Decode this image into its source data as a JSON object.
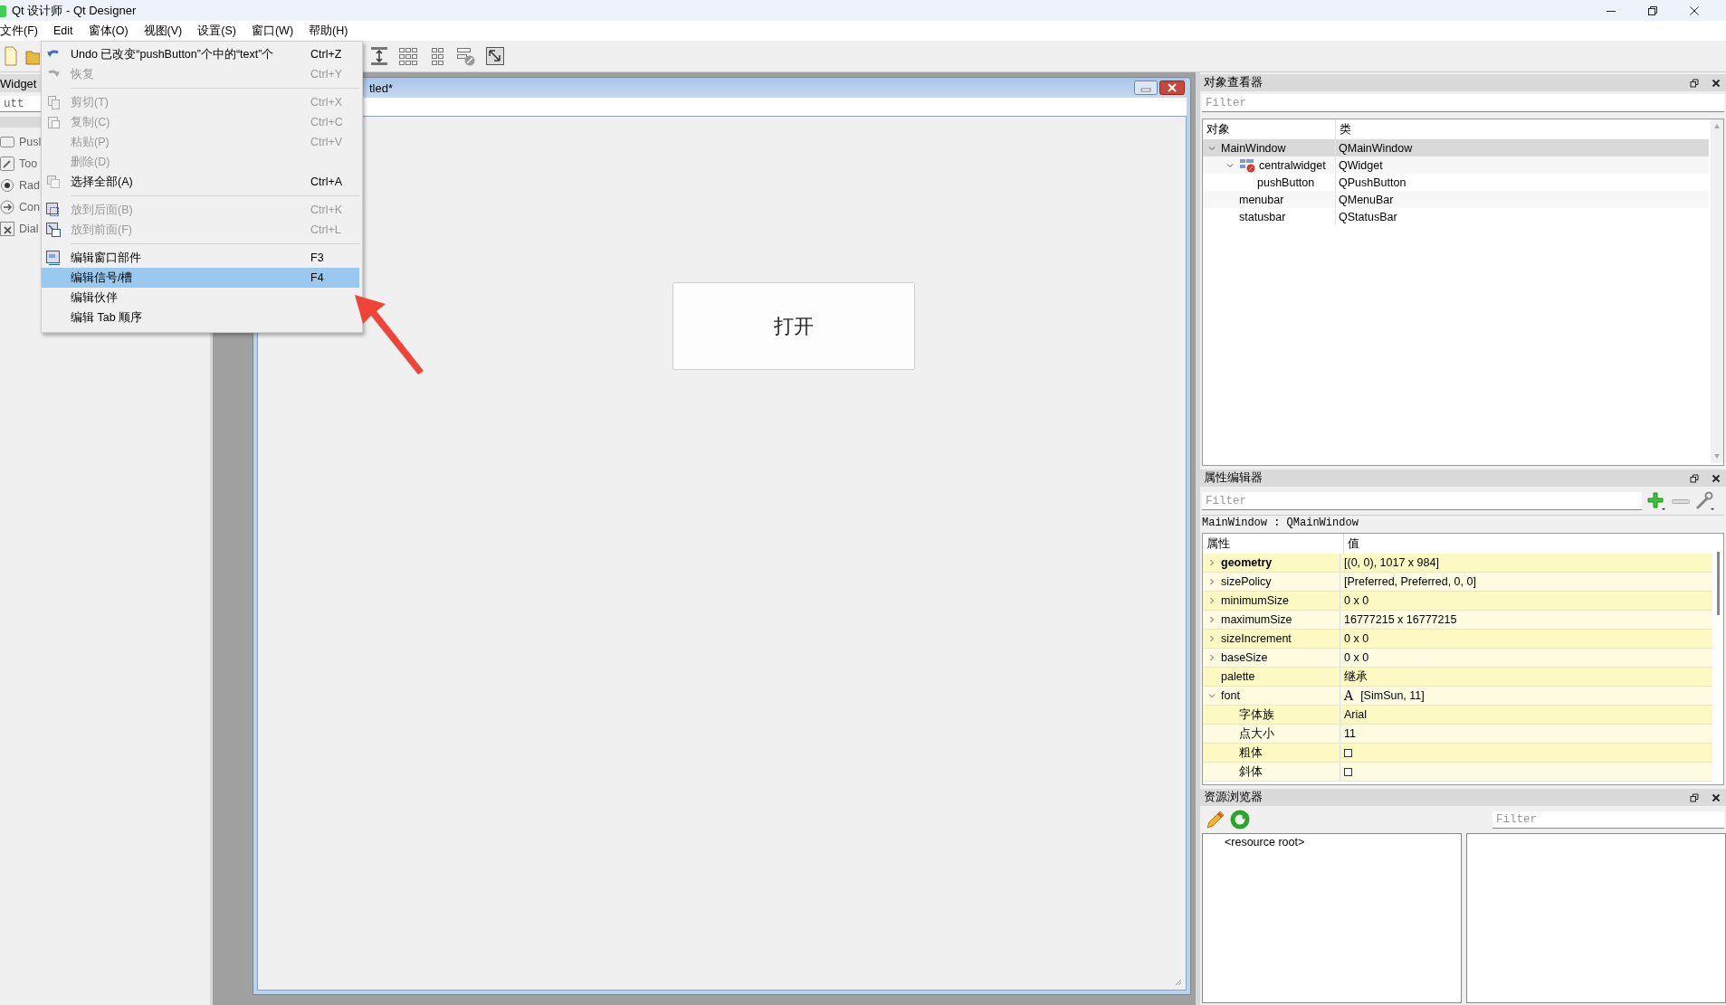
{
  "window": {
    "title": "Qt 设计师 - Qt Designer"
  },
  "menubar": [
    {
      "label": "文件(F)"
    },
    {
      "label": "Edit"
    },
    {
      "label": "窗体(O)"
    },
    {
      "label": "视图(V)"
    },
    {
      "label": "设置(S)"
    },
    {
      "label": "窗口(W)"
    },
    {
      "label": "帮助(H)"
    }
  ],
  "edit_menu": {
    "items": [
      {
        "kind": "item",
        "label": "Undo 已改变“pushButton”个中的“text”个",
        "shortcut": "Ctrl+Z",
        "disabled": false,
        "selected": false
      },
      {
        "kind": "item",
        "label": "恢复",
        "shortcut": "Ctrl+Y",
        "disabled": true,
        "selected": false
      },
      {
        "kind": "separator"
      },
      {
        "kind": "item",
        "label": "剪切(T)",
        "shortcut": "Ctrl+X",
        "disabled": true,
        "selected": false
      },
      {
        "kind": "item",
        "label": "复制(C)",
        "shortcut": "Ctrl+C",
        "disabled": true,
        "selected": false
      },
      {
        "kind": "item",
        "label": "粘贴(P)",
        "shortcut": "Ctrl+V",
        "disabled": true,
        "selected": false
      },
      {
        "kind": "item",
        "label": "删除(D)",
        "disabled": true,
        "selected": false
      },
      {
        "kind": "item",
        "label": "选择全部(A)",
        "shortcut": "Ctrl+A",
        "disabled": false,
        "selected": false
      },
      {
        "kind": "separator"
      },
      {
        "kind": "item",
        "label": "放到后面(B)",
        "shortcut": "Ctrl+K",
        "disabled": true,
        "selected": false
      },
      {
        "kind": "item",
        "label": "放到前面(F)",
        "shortcut": "Ctrl+L",
        "disabled": true,
        "selected": false
      },
      {
        "kind": "separator"
      },
      {
        "kind": "item",
        "label": "编辑窗口部件",
        "shortcut": "F3",
        "disabled": false,
        "selected": false
      },
      {
        "kind": "item",
        "label": "编辑信号/槽",
        "shortcut": "F4",
        "disabled": false,
        "selected": true
      },
      {
        "kind": "item",
        "label": "编辑伙伴",
        "disabled": false,
        "selected": false
      },
      {
        "kind": "item",
        "label": "编辑 Tab 顺序",
        "disabled": false,
        "selected": false
      }
    ]
  },
  "widget_box": {
    "title": "Widget",
    "filter": {
      "value": "utt"
    },
    "items": [
      "Pusl",
      "Too",
      "Rad",
      "Con",
      "Dial"
    ]
  },
  "form_window": {
    "title": "tled*",
    "push_button": {
      "label": "打开"
    }
  },
  "object_inspector": {
    "title": "对象查看器",
    "filter": {
      "placeholder": "Filter"
    },
    "columns": [
      "对象",
      "类"
    ],
    "tree": [
      {
        "name": "MainWindow",
        "class": "QMainWindow",
        "expanded": true,
        "selected": true,
        "children": [
          {
            "name": "centralwidget",
            "class": "QWidget",
            "expanded": true,
            "selected": false,
            "children": [
              {
                "name": "pushButton",
                "class": "QPushButton",
                "selected": false
              }
            ]
          },
          {
            "name": "menubar",
            "class": "QMenuBar",
            "selected": false
          },
          {
            "name": "statusbar",
            "class": "QStatusBar",
            "selected": false
          }
        ]
      }
    ]
  },
  "property_editor": {
    "title": "属性编辑器",
    "filter": {
      "placeholder": "Filter"
    },
    "class_label": "MainWindow : QMainWindow",
    "columns": [
      "属性",
      "值"
    ],
    "properties": [
      {
        "kind": "text",
        "name": "geometry",
        "value": "[(0, 0), 1017 x 984]",
        "modified": true,
        "expanded": false
      },
      {
        "kind": "text",
        "name": "sizePolicy",
        "value": "[Preferred, Preferred, 0, 0]",
        "modified": false,
        "expanded": false
      },
      {
        "kind": "text",
        "name": "minimumSize",
        "value": "0 x 0",
        "modified": false,
        "expanded": false
      },
      {
        "kind": "text",
        "name": "maximumSize",
        "value": "16777215 x 16777215",
        "modified": false,
        "expanded": false
      },
      {
        "kind": "text",
        "name": "sizeIncrement",
        "value": "0 x 0",
        "modified": false,
        "expanded": false
      },
      {
        "kind": "text",
        "name": "baseSize",
        "value": "0 x 0",
        "modified": false,
        "expanded": false
      },
      {
        "kind": "text",
        "name": "palette",
        "value": "继承",
        "modified": false
      },
      {
        "kind": "text",
        "name": "font",
        "glyph": "A",
        "value": "[SimSun, 11]",
        "modified": false,
        "expanded": true,
        "children": [
          {
            "kind": "text",
            "name": "字体族",
            "value": "Arial",
            "modified": false
          },
          {
            "kind": "text",
            "name": "点大小",
            "value": "11",
            "modified": false
          },
          {
            "kind": "checkbox",
            "name": "粗体",
            "checked": false,
            "modified": false
          },
          {
            "kind": "checkbox",
            "name": "斜体",
            "checked": false,
            "modified": false
          }
        ]
      }
    ]
  },
  "resource_browser": {
    "title": "资源浏览器",
    "filter": {
      "placeholder": "Filter"
    },
    "items": [
      "<resource root>"
    ]
  }
}
